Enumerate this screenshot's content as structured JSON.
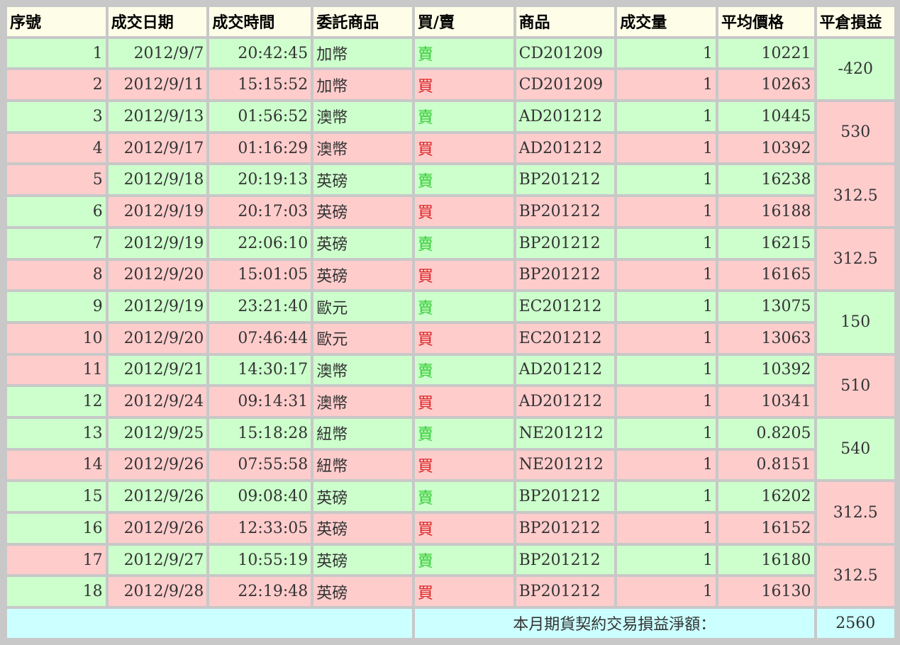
{
  "headers": [
    "序號",
    "成交日期",
    "成交時間",
    "委託商品",
    "買/賣",
    "商品",
    "成交量",
    "平均價格",
    "平倉損益"
  ],
  "rows": [
    {
      "no": "1",
      "date": "2012/9/7",
      "time": "20:42:45",
      "item": "加幣",
      "side": "賣",
      "code": "CD201209",
      "qty": "1",
      "price": "10221"
    },
    {
      "no": "2",
      "date": "2012/9/11",
      "time": "15:15:52",
      "item": "加幣",
      "side": "買",
      "code": "CD201209",
      "qty": "1",
      "price": "10263"
    },
    {
      "no": "3",
      "date": "2012/9/13",
      "time": "01:56:52",
      "item": "澳幣",
      "side": "賣",
      "code": "AD201212",
      "qty": "1",
      "price": "10445"
    },
    {
      "no": "4",
      "date": "2012/9/17",
      "time": "01:16:29",
      "item": "澳幣",
      "side": "買",
      "code": "AD201212",
      "qty": "1",
      "price": "10392"
    },
    {
      "no": "5",
      "date": "2012/9/18",
      "time": "20:19:13",
      "item": "英磅",
      "side": "賣",
      "code": "BP201212",
      "qty": "1",
      "price": "16238"
    },
    {
      "no": "6",
      "date": "2012/9/19",
      "time": "20:17:03",
      "item": "英磅",
      "side": "買",
      "code": "BP201212",
      "qty": "1",
      "price": "16188"
    },
    {
      "no": "7",
      "date": "2012/9/19",
      "time": "22:06:10",
      "item": "英磅",
      "side": "賣",
      "code": "BP201212",
      "qty": "1",
      "price": "16215"
    },
    {
      "no": "8",
      "date": "2012/9/20",
      "time": "15:01:05",
      "item": "英磅",
      "side": "買",
      "code": "BP201212",
      "qty": "1",
      "price": "16165"
    },
    {
      "no": "9",
      "date": "2012/9/19",
      "time": "23:21:40",
      "item": "歐元",
      "side": "賣",
      "code": "EC201212",
      "qty": "1",
      "price": "13075"
    },
    {
      "no": "10",
      "date": "2012/9/20",
      "time": "07:46:44",
      "item": "歐元",
      "side": "買",
      "code": "EC201212",
      "qty": "1",
      "price": "13063"
    },
    {
      "no": "11",
      "date": "2012/9/21",
      "time": "14:30:17",
      "item": "澳幣",
      "side": "賣",
      "code": "AD201212",
      "qty": "1",
      "price": "10392"
    },
    {
      "no": "12",
      "date": "2012/9/24",
      "time": "09:14:31",
      "item": "澳幣",
      "side": "買",
      "code": "AD201212",
      "qty": "1",
      "price": "10341"
    },
    {
      "no": "13",
      "date": "2012/9/25",
      "time": "15:18:28",
      "item": "紐幣",
      "side": "賣",
      "code": "NE201212",
      "qty": "1",
      "price": "0.8205"
    },
    {
      "no": "14",
      "date": "2012/9/26",
      "time": "07:55:58",
      "item": "紐幣",
      "side": "買",
      "code": "NE201212",
      "qty": "1",
      "price": "0.8151"
    },
    {
      "no": "15",
      "date": "2012/9/26",
      "time": "09:08:40",
      "item": "英磅",
      "side": "賣",
      "code": "BP201212",
      "qty": "1",
      "price": "16202"
    },
    {
      "no": "16",
      "date": "2012/9/26",
      "time": "12:33:05",
      "item": "英磅",
      "side": "買",
      "code": "BP201212",
      "qty": "1",
      "price": "16152"
    },
    {
      "no": "17",
      "date": "2012/9/27",
      "time": "10:55:19",
      "item": "英磅",
      "side": "賣",
      "code": "BP201212",
      "qty": "1",
      "price": "16180"
    },
    {
      "no": "18",
      "date": "2012/9/28",
      "time": "22:19:48",
      "item": "英磅",
      "side": "買",
      "code": "BP201212",
      "qty": "1",
      "price": "16130"
    }
  ],
  "pnl": [
    "-420",
    "530",
    "312.5",
    "312.5",
    "150",
    "510",
    "540",
    "312.5",
    "312.5"
  ],
  "footer": {
    "label": "本月期貨契約交易損益淨額：",
    "total": "2560"
  },
  "colors": {
    "green_row": "#ccffcc",
    "pink_row": "#ffcccc",
    "header_bg": "#fefee8",
    "footer_bg": "#ccffff",
    "sell_text": "#33cc33",
    "buy_text": "#dd2222",
    "grid": "#c8c8c8"
  }
}
